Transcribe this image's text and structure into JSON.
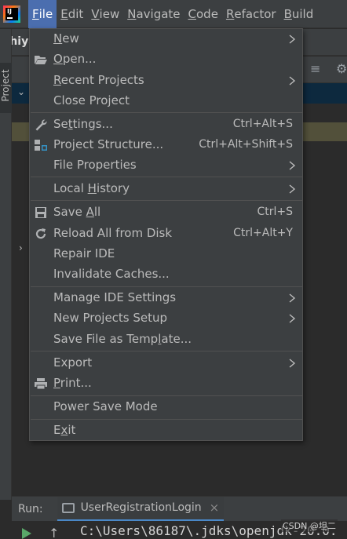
{
  "menubar": {
    "logo_icon": "intellij-idea-icon",
    "items": [
      {
        "pre": "",
        "mn": "F",
        "post": "ile"
      },
      {
        "pre": "",
        "mn": "E",
        "post": "dit"
      },
      {
        "pre": "",
        "mn": "V",
        "post": "iew"
      },
      {
        "pre": "",
        "mn": "N",
        "post": "avigate"
      },
      {
        "pre": "",
        "mn": "C",
        "post": "ode"
      },
      {
        "pre": "",
        "mn": "R",
        "post": "efactor"
      },
      {
        "pre": "",
        "mn": "B",
        "post": "uild"
      }
    ]
  },
  "project": {
    "title_partial": "shiya",
    "tab_label": "Project"
  },
  "file_menu": {
    "items": [
      {
        "icon": "",
        "pre": "",
        "mn": "N",
        "post": "ew",
        "shortcut": "",
        "submenu": true
      },
      {
        "icon": "folder-open-icon",
        "pre": "",
        "mn": "O",
        "post": "pen...",
        "shortcut": "",
        "submenu": false
      },
      {
        "icon": "",
        "pre": "",
        "mn": "R",
        "post": "ecent Projects",
        "shortcut": "",
        "submenu": true
      },
      {
        "icon": "",
        "pre": "Close Project",
        "mn": "",
        "post": "",
        "shortcut": "",
        "submenu": false
      },
      {
        "icon": "wrench-icon",
        "pre": "Se",
        "mn": "t",
        "post": "tings...",
        "shortcut": "Ctrl+Alt+S",
        "submenu": false
      },
      {
        "icon": "project-structure-icon",
        "pre": "Project Structure...",
        "mn": "",
        "post": "",
        "shortcut": "Ctrl+Alt+Shift+S",
        "submenu": false
      },
      {
        "icon": "",
        "pre": "File Properties",
        "mn": "",
        "post": "",
        "shortcut": "",
        "submenu": true
      },
      {
        "icon": "",
        "pre": "Local ",
        "mn": "H",
        "post": "istory",
        "shortcut": "",
        "submenu": true
      },
      {
        "icon": "save-icon",
        "pre": "Save ",
        "mn": "A",
        "post": "ll",
        "shortcut": "Ctrl+S",
        "submenu": false
      },
      {
        "icon": "reload-icon",
        "pre": "Reload All from Disk",
        "mn": "",
        "post": "",
        "shortcut": "Ctrl+Alt+Y",
        "submenu": false
      },
      {
        "icon": "",
        "pre": "Repair IDE",
        "mn": "",
        "post": "",
        "shortcut": "",
        "submenu": false
      },
      {
        "icon": "",
        "pre": "Invalidate Caches...",
        "mn": "",
        "post": "",
        "shortcut": "",
        "submenu": false
      },
      {
        "icon": "",
        "pre": "Manage IDE Settings",
        "mn": "",
        "post": "",
        "shortcut": "",
        "submenu": true
      },
      {
        "icon": "",
        "pre": "New Projects Setup",
        "mn": "",
        "post": "",
        "shortcut": "",
        "submenu": true
      },
      {
        "icon": "",
        "pre": "Save File as Temp",
        "mn": "l",
        "post": "ate...",
        "shortcut": "",
        "submenu": false
      },
      {
        "icon": "",
        "pre": "Export",
        "mn": "",
        "post": "",
        "shortcut": "",
        "submenu": true
      },
      {
        "icon": "print-icon",
        "pre": "",
        "mn": "P",
        "post": "rint...",
        "shortcut": "",
        "submenu": false
      },
      {
        "icon": "",
        "pre": "Power Save Mode",
        "mn": "",
        "post": "",
        "shortcut": "",
        "submenu": false
      },
      {
        "icon": "",
        "pre": "E",
        "mn": "x",
        "post": "it",
        "shortcut": "",
        "submenu": false
      }
    ]
  },
  "run_panel": {
    "label": "Run:",
    "tab_label": "UserRegistrationLogin",
    "console_text": "C:\\Users\\86187\\.jdks\\openjdk-20.0."
  },
  "watermark": "CSDN @坦二",
  "colors": {
    "menu_bg": "#3c3f41",
    "active_menu": "#4b6eaf",
    "editor_bg": "#2b2b2b",
    "text": "#bbbbbb"
  }
}
